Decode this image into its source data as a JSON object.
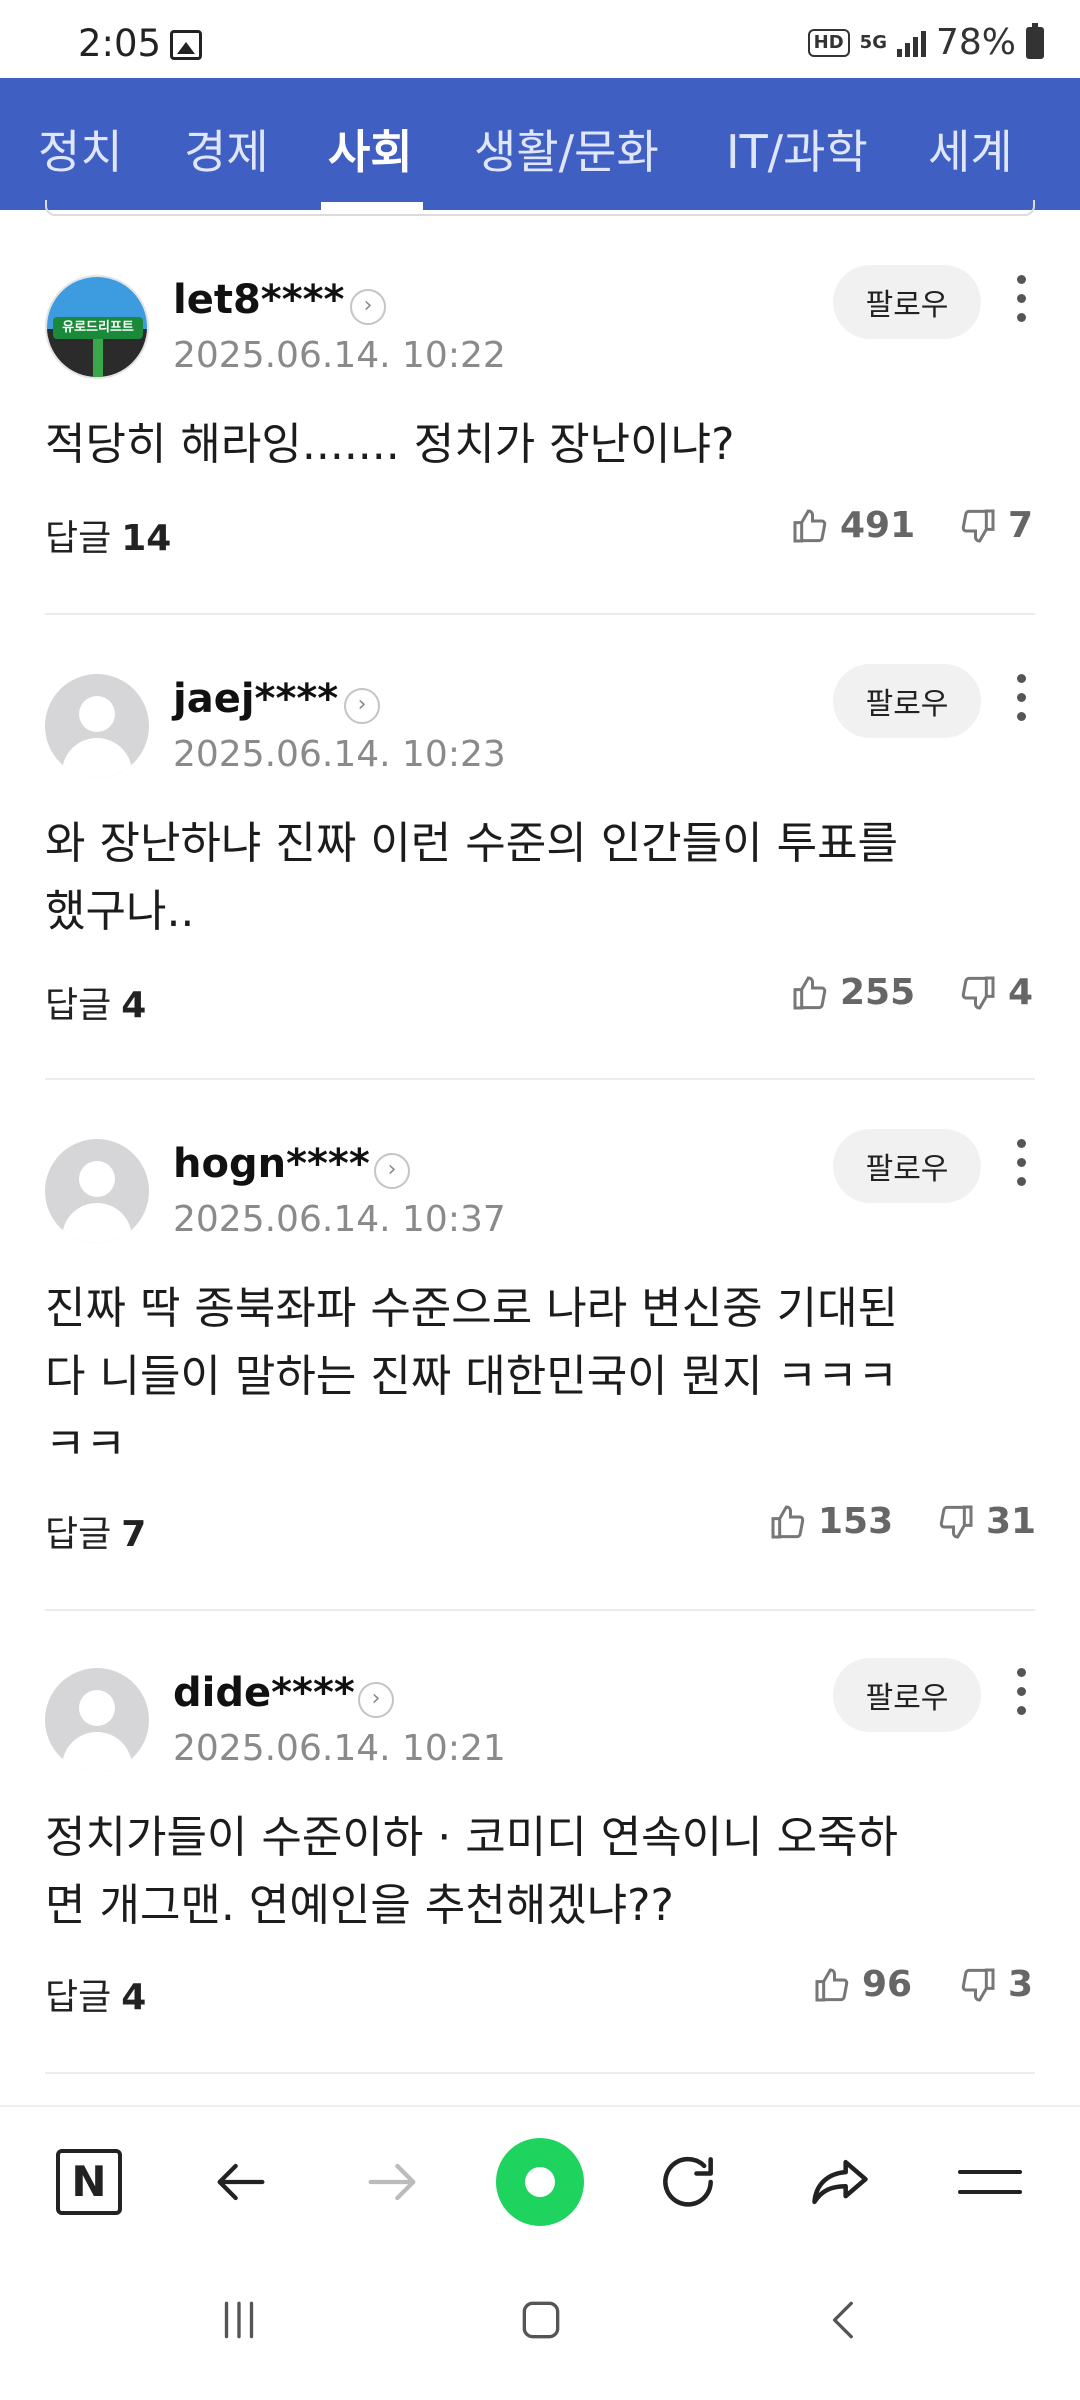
{
  "status_bar": {
    "time": "2:05",
    "hd": "HD",
    "network": "5G",
    "battery": "78%"
  },
  "categories": [
    "정치",
    "경제",
    "사회",
    "생활/문화",
    "IT/과학",
    "세계"
  ],
  "active_category": "사회",
  "follow_label": "팔로우",
  "reply_label": "답글",
  "comments": [
    {
      "username": "let8****",
      "timestamp": "2025.06.14. 10:22",
      "text": "적당히 해라잉....... 정치가 장난이냐?",
      "replies": "14",
      "likes": "491",
      "dislikes": "7",
      "avatar": "road-image",
      "avatar_text": "유로드리프트"
    },
    {
      "username": "jaej****",
      "timestamp": "2025.06.14. 10:23",
      "text": "와 장난하냐 진짜 이런 수준의 인간들이 투표를\n했구나..",
      "replies": "4",
      "likes": "255",
      "dislikes": "4",
      "avatar": "default-avatar"
    },
    {
      "username": "hogn****",
      "timestamp": "2025.06.14. 10:37",
      "text": "진짜 딱 종북좌파 수준으로 나라 변신중 기대된\n다 니들이 말하는 진짜 대한민국이 뭔지 ㅋㅋㅋ\nㅋㅋ",
      "replies": "7",
      "likes": "153",
      "dislikes": "31",
      "avatar": "default-avatar"
    },
    {
      "username": "dide****",
      "timestamp": "2025.06.14. 10:21",
      "text": "정치가들이 수준이하 · 코미디 연속이니 오죽하\n면 개그맨. 연예인을 추천해겠냐??",
      "replies": "4",
      "likes": "96",
      "dislikes": "3",
      "avatar": "default-avatar"
    }
  ],
  "toolbar": {
    "logo": "N",
    "icons": [
      "naver-home-icon",
      "back-arrow-icon",
      "forward-arrow-icon",
      "green-dot-icon",
      "refresh-icon",
      "share-icon",
      "menu-icon"
    ]
  },
  "system_nav": [
    "recent-apps-icon",
    "home-icon",
    "back-icon"
  ],
  "colors": {
    "nav_bar": "#3f5fc2",
    "green_button": "#1ed35e",
    "timestamp": "#8a8a8a"
  }
}
